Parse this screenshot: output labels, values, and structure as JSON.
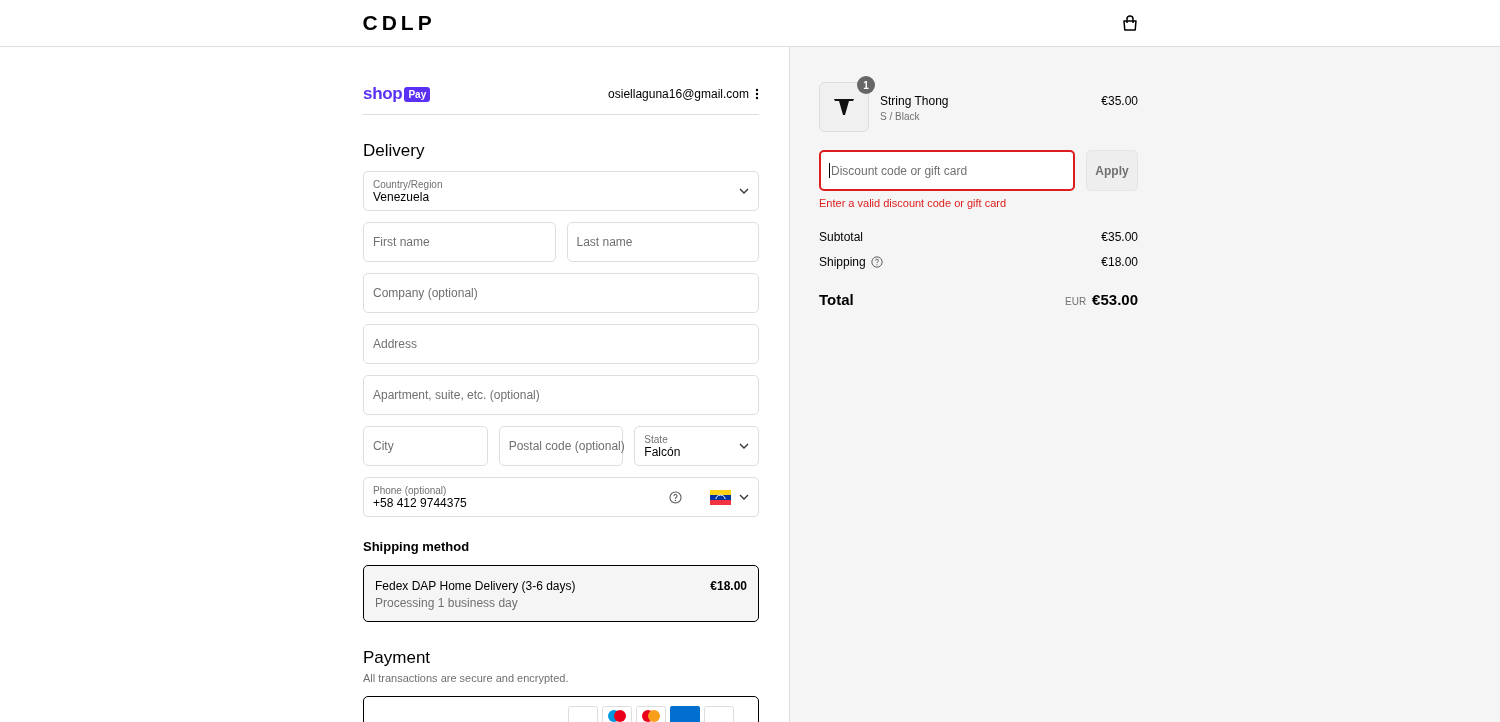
{
  "header": {
    "logo": "CDLP"
  },
  "express": {
    "wordmark": "shop",
    "badge": "Pay",
    "email": "osiellaguna16@gmail.com"
  },
  "delivery": {
    "title": "Delivery",
    "rows": [
      [
        {
          "kind": "select",
          "label": "Country/Region",
          "value": "Venezuela"
        }
      ],
      [
        {
          "kind": "input",
          "placeholder": "First name"
        },
        {
          "kind": "input",
          "placeholder": "Last name"
        }
      ],
      [
        {
          "kind": "input",
          "placeholder": "Company (optional)"
        }
      ],
      [
        {
          "kind": "input",
          "placeholder": "Address"
        }
      ],
      [
        {
          "kind": "input",
          "placeholder": "Apartment, suite, etc. (optional)"
        }
      ],
      [
        {
          "kind": "input",
          "placeholder": "City"
        },
        {
          "kind": "input",
          "placeholder": "Postal code (optional)"
        },
        {
          "kind": "select",
          "label": "State",
          "value": "Falcón"
        }
      ],
      [
        {
          "kind": "phone",
          "label": "Phone (optional)",
          "value": "+58 412 9744375"
        }
      ]
    ]
  },
  "shipping": {
    "title": "Shipping method",
    "options": [
      {
        "name": "Fedex DAP Home Delivery (3-6 days)",
        "note": "Processing 1 business day",
        "price": "€18.00",
        "selected": true
      }
    ]
  },
  "payment": {
    "title": "Payment",
    "note": "All transactions are secure and encrypted."
  },
  "summary": {
    "items": [
      {
        "name": "String Thong",
        "variant": "S / Black",
        "price": "€35.00",
        "quantity": "1"
      }
    ],
    "discount": {
      "placeholder": "Discount code or gift card",
      "button": "Apply",
      "error": "Enter a valid discount code or gift card"
    },
    "lines": [
      {
        "label": "Subtotal",
        "value": "€35.00",
        "info": false
      },
      {
        "label": "Shipping",
        "value": "€18.00",
        "info": true
      }
    ],
    "total": {
      "label": "Total",
      "currency": "EUR",
      "amount": "€53.00"
    }
  }
}
